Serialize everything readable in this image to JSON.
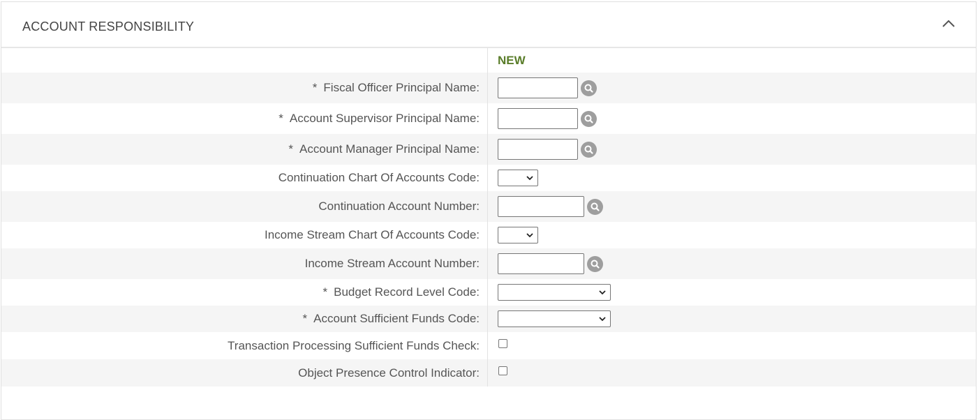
{
  "panel": {
    "title": "ACCOUNT RESPONSIBILITY",
    "collapse_icon": "chevron-up-icon"
  },
  "column_header": "NEW",
  "required_marker": "*",
  "fields": {
    "fiscal_officer": {
      "label": "Fiscal Officer Principal Name:",
      "value": ""
    },
    "account_supervisor": {
      "label": "Account Supervisor Principal Name:",
      "value": ""
    },
    "account_manager": {
      "label": "Account Manager Principal Name:",
      "value": ""
    },
    "continuation_coa": {
      "label": "Continuation Chart Of Accounts Code:",
      "selected": ""
    },
    "continuation_account": {
      "label": "Continuation Account Number:",
      "value": ""
    },
    "income_stream_coa": {
      "label": "Income Stream Chart Of Accounts Code:",
      "selected": ""
    },
    "income_stream_account": {
      "label": "Income Stream Account Number:",
      "value": ""
    },
    "budget_record_level": {
      "label": "Budget Record Level Code:",
      "selected": ""
    },
    "sufficient_funds_code": {
      "label": "Account Sufficient Funds Code:",
      "selected": ""
    },
    "tp_sufficient_funds_check": {
      "label": "Transaction Processing Sufficient Funds Check:",
      "checked": false
    },
    "object_presence_control": {
      "label": "Object Presence Control Indicator:",
      "checked": false
    }
  },
  "icons": {
    "search": "search-icon",
    "dropdown": "chevron-down-icon"
  },
  "colors": {
    "accent_green": "#5a7d2a",
    "row_shade": "#f5f5f5",
    "search_icon_bg": "#9e9e9e"
  }
}
